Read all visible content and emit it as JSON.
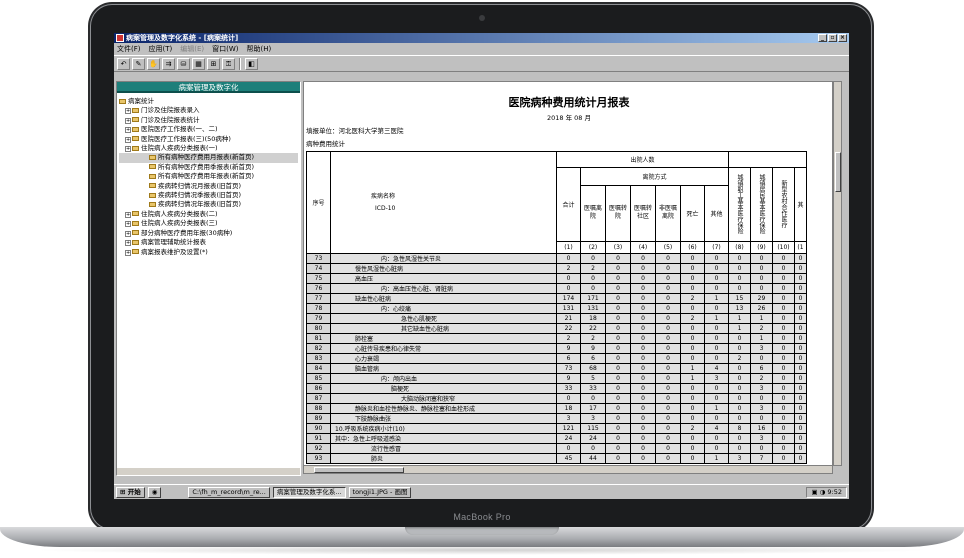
{
  "device": {
    "brand": "MacBook Pro"
  },
  "window": {
    "title": "病案管理及数字化系统 - [病案统计]",
    "controls": [
      "_",
      "▫",
      "×"
    ]
  },
  "menu": {
    "file": "文件(F)",
    "apply": "应用(T)",
    "edit": "编辑(E)",
    "window": "窗口(W)",
    "help": "帮助(H)"
  },
  "toolbar": {
    "buttons": [
      "↶",
      "✎",
      "✋",
      "⇉",
      "⛁",
      "▦",
      "⊞",
      "⚿",
      "◧"
    ]
  },
  "left_panel": {
    "header": "病案管理及数字化",
    "tree": [
      {
        "label": "病案统计",
        "level": 0
      },
      {
        "label": "门诊及住院报表录入",
        "level": 1
      },
      {
        "label": "门诊及住院报表统计",
        "level": 1
      },
      {
        "label": "医院医疗工作报表(一、二)",
        "level": 1
      },
      {
        "label": "医院医疗工作报表(三)(50病种)",
        "level": 1
      },
      {
        "label": "住院病人疾病分类报表(一)",
        "level": 1
      },
      {
        "label": "所有病种医疗费用月报表(新首页)",
        "level": 2,
        "selected": true
      },
      {
        "label": "所有病种医疗费用季报表(新首页)",
        "level": 2
      },
      {
        "label": "所有病种医疗费用年报表(新首页)",
        "level": 2
      },
      {
        "label": "疾病转归情况月报表(旧首页)",
        "level": 2
      },
      {
        "label": "疾病转归情况季报表(旧首页)",
        "level": 2
      },
      {
        "label": "疾病转归情况年报表(旧首页)",
        "level": 2
      },
      {
        "label": "住院病人疾病分类报表(二)",
        "level": 1
      },
      {
        "label": "住院病人疾病分类报表(三)",
        "level": 1
      },
      {
        "label": "部分病种医疗费用年报(30病种)",
        "level": 1
      },
      {
        "label": "病案管理辅助统计报表",
        "level": 1
      },
      {
        "label": "病案报表维护及设置(*)",
        "level": 1
      }
    ]
  },
  "report": {
    "title": "医院病种费用统计月报表",
    "date": "2018 年 08 月",
    "unit": "填报单位：河北医科大学第三医院",
    "subtitle": "病种费用统计",
    "headers": {
      "seq": "序号",
      "name": "疾病名称",
      "icd": "ICD-10",
      "discharged": "出院人数",
      "total": "合计",
      "leave_mode": "离院方式",
      "doctor_order": "医嘱离院",
      "transfer": "医嘱转院",
      "community": "医嘱转社区",
      "non_doctor": "非医嘱离院",
      "death": "死亡",
      "other": "其他",
      "urban_worker": "城镇职工基本医疗保险",
      "urban_resident": "城镇居民基本医疗保险",
      "rural_coop": "新型农村合作医疗",
      "col11": "其"
    },
    "col_numbers": [
      "(1)",
      "(2)",
      "(3)",
      "(4)",
      "(5)",
      "(6)",
      "(7)",
      "(8)",
      "(9)",
      "(10)",
      "(1"
    ],
    "rows": [
      {
        "seq": "73",
        "name": "内：急性风湿性关节炎",
        "v": [
          "0",
          "0",
          "0",
          "0",
          "0",
          "0",
          "0",
          "0",
          "0",
          "0",
          "0"
        ]
      },
      {
        "seq": "74",
        "name": "慢性风湿性心脏病",
        "v": [
          "2",
          "2",
          "0",
          "0",
          "0",
          "0",
          "0",
          "0",
          "0",
          "0",
          "0"
        ]
      },
      {
        "seq": "75",
        "name": "高血压",
        "v": [
          "0",
          "0",
          "0",
          "0",
          "0",
          "0",
          "0",
          "0",
          "0",
          "0",
          "0"
        ]
      },
      {
        "seq": "76",
        "name": "内：高血压性心脏、肾脏病",
        "v": [
          "0",
          "0",
          "0",
          "0",
          "0",
          "0",
          "0",
          "0",
          "0",
          "0",
          "0"
        ]
      },
      {
        "seq": "77",
        "name": "缺血性心脏病",
        "v": [
          "174",
          "171",
          "0",
          "0",
          "0",
          "2",
          "1",
          "15",
          "29",
          "0",
          "0"
        ]
      },
      {
        "seq": "78",
        "name": "内：心绞痛",
        "v": [
          "131",
          "131",
          "0",
          "0",
          "0",
          "0",
          "0",
          "13",
          "26",
          "0",
          "0"
        ]
      },
      {
        "seq": "79",
        "name": "急性心肌梗死",
        "v": [
          "21",
          "18",
          "0",
          "0",
          "0",
          "2",
          "1",
          "1",
          "1",
          "0",
          "0"
        ]
      },
      {
        "seq": "80",
        "name": "其它缺血性心脏病",
        "v": [
          "22",
          "22",
          "0",
          "0",
          "0",
          "0",
          "0",
          "1",
          "2",
          "0",
          "0"
        ]
      },
      {
        "seq": "81",
        "name": "肺栓塞",
        "v": [
          "2",
          "2",
          "0",
          "0",
          "0",
          "0",
          "0",
          "0",
          "1",
          "0",
          "0"
        ]
      },
      {
        "seq": "82",
        "name": "心脏传导疾患和心律失常",
        "v": [
          "9",
          "9",
          "0",
          "0",
          "0",
          "0",
          "0",
          "0",
          "3",
          "0",
          "0"
        ]
      },
      {
        "seq": "83",
        "name": "心力衰竭",
        "v": [
          "6",
          "6",
          "0",
          "0",
          "0",
          "0",
          "0",
          "2",
          "0",
          "0",
          "0"
        ]
      },
      {
        "seq": "84",
        "name": "脑血管病",
        "v": [
          "73",
          "68",
          "0",
          "0",
          "0",
          "1",
          "4",
          "0",
          "6",
          "0",
          "0"
        ]
      },
      {
        "seq": "85",
        "name": "内：颅内出血",
        "v": [
          "9",
          "5",
          "0",
          "0",
          "0",
          "1",
          "3",
          "0",
          "2",
          "0",
          "0"
        ]
      },
      {
        "seq": "86",
        "name": "脑梗死",
        "v": [
          "33",
          "33",
          "0",
          "0",
          "0",
          "0",
          "0",
          "0",
          "3",
          "0",
          "0"
        ]
      },
      {
        "seq": "87",
        "name": "大脑动脉闭塞和狭窄",
        "v": [
          "0",
          "0",
          "0",
          "0",
          "0",
          "0",
          "0",
          "0",
          "0",
          "0",
          "0"
        ]
      },
      {
        "seq": "88",
        "name": "静脉炎和血栓性静脉炎、静脉栓塞和血栓形成",
        "v": [
          "18",
          "17",
          "0",
          "0",
          "0",
          "0",
          "1",
          "0",
          "3",
          "0",
          "0"
        ]
      },
      {
        "seq": "89",
        "name": "下肢静脉曲张",
        "v": [
          "3",
          "3",
          "0",
          "0",
          "0",
          "0",
          "0",
          "0",
          "0",
          "0",
          "0"
        ]
      },
      {
        "seq": "90",
        "name": "10.呼吸系统疾病小计(10)",
        "v": [
          "121",
          "115",
          "0",
          "0",
          "0",
          "2",
          "4",
          "8",
          "16",
          "0",
          "0"
        ]
      },
      {
        "seq": "91",
        "name": "其中：急性上呼吸道感染",
        "v": [
          "24",
          "24",
          "0",
          "0",
          "0",
          "0",
          "0",
          "0",
          "3",
          "0",
          "0"
        ]
      },
      {
        "seq": "92",
        "name": "流行性感冒",
        "v": [
          "0",
          "0",
          "0",
          "0",
          "0",
          "0",
          "0",
          "0",
          "0",
          "0",
          "0"
        ]
      },
      {
        "seq": "93",
        "name": "肺炎",
        "v": [
          "45",
          "44",
          "0",
          "0",
          "0",
          "0",
          "1",
          "3",
          "7",
          "0",
          "0"
        ]
      }
    ]
  },
  "taskbar": {
    "start": "开始",
    "tasks": [
      "C:\\fh_m_record\\m_re...",
      "病案管理及数字化系...",
      "tongji1.JPG - 画图"
    ],
    "time": "9:52"
  },
  "colors": {
    "panel_header": "#1d7f7a",
    "titlebar": "#0a246a",
    "desktop": "#c0c0c0"
  }
}
